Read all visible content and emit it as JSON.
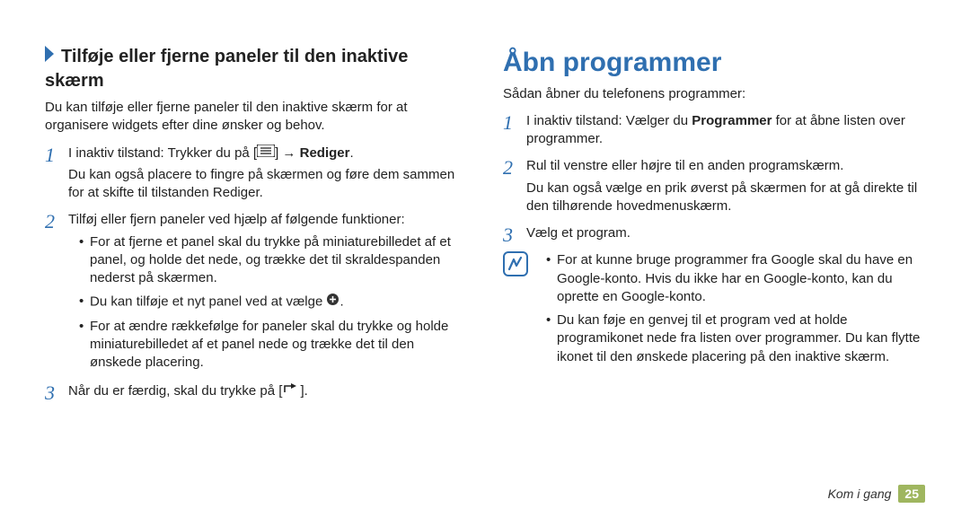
{
  "left": {
    "heading": "Tilføje eller fjerne paneler til den inaktive skærm",
    "intro": "Du kan tilføje eller fjerne paneler til den inaktive skærm for at organisere widgets efter dine ønsker og behov.",
    "step1a_prefix": "I inaktiv tilstand: Trykker du på [",
    "step1a_mid": "] → ",
    "step1a_bold": "Rediger",
    "step1a_suffix": ".",
    "step1b": "Du kan også placere to fingre på skærmen og føre dem sammen for at skifte til tilstanden Rediger.",
    "step2_intro": "Tilføj eller fjern paneler ved hjælp af følgende funktioner:",
    "step2_b1": "For at fjerne et panel skal du trykke på miniaturebilledet af et panel, og holde det nede, og trække det til skraldespanden nederst på skærmen.",
    "step2_b2_prefix": "Du kan tilføje et nyt panel ved at vælge ",
    "step2_b2_suffix": ".",
    "step2_b3": "For at ændre rækkefølge for paneler skal du trykke og holde miniaturebilledet af et panel nede og trække det til den ønskede placering.",
    "step3_prefix": "Når du er færdig, skal du trykke på [",
    "step3_suffix": "]."
  },
  "right": {
    "title": "Åbn programmer",
    "intro": "Sådan åbner du telefonens programmer:",
    "step1_prefix": "I inaktiv tilstand: Vælger du ",
    "step1_bold": "Programmer",
    "step1_suffix": " for at åbne listen over programmer.",
    "step2a": "Rul til venstre eller højre til en anden programskærm.",
    "step2b": "Du kan også vælge en prik øverst på skærmen for at gå direkte til den tilhørende hovedmenuskærm.",
    "step3": "Vælg et program.",
    "note_b1": "For at kunne bruge programmer fra Google skal du have en Google-konto. Hvis du ikke har en Google-konto, kan du oprette en Google-konto.",
    "note_b2": "Du kan føje en genvej til et program ved at holde programikonet nede fra listen over programmer. Du kan flytte ikonet til den ønskede placering på den inaktive skærm."
  },
  "footer": {
    "label": "Kom i gang",
    "page": "25"
  }
}
